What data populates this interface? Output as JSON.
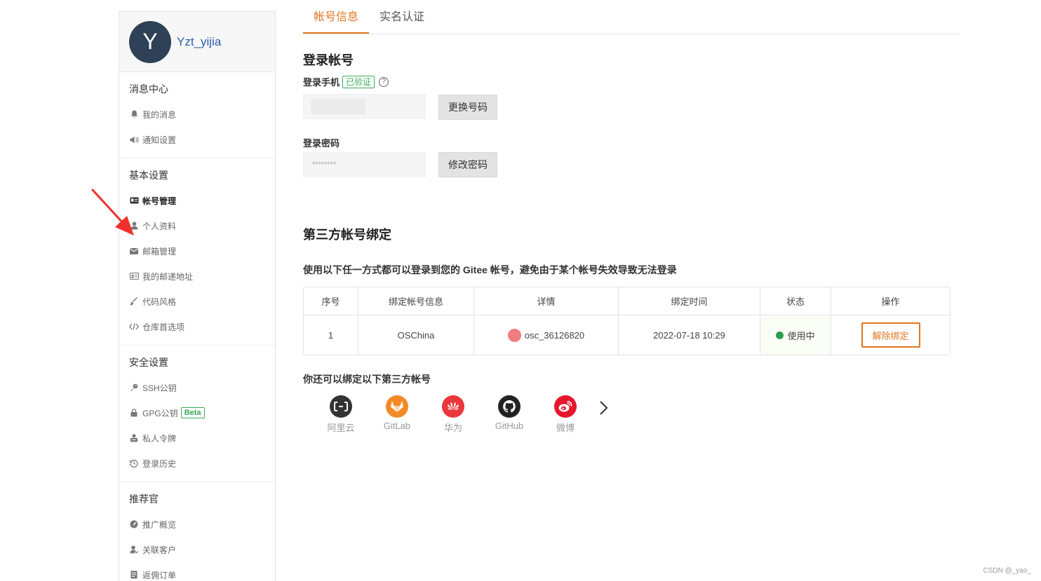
{
  "profile": {
    "avatar_letter": "Y",
    "username": "Yzt_yijia"
  },
  "sidebar": {
    "groups": [
      {
        "title": "消息中心",
        "items": [
          {
            "label": "我的消息",
            "icon": "bell-icon"
          },
          {
            "label": "通知设置",
            "icon": "speaker-icon"
          }
        ]
      },
      {
        "title": "基本设置",
        "items": [
          {
            "label": "帐号管理",
            "icon": "id-card-icon"
          },
          {
            "label": "个人资料",
            "icon": "user-icon"
          },
          {
            "label": "邮箱管理",
            "icon": "mail-icon"
          },
          {
            "label": "我的邮递地址",
            "icon": "address-card-icon"
          },
          {
            "label": "代码风格",
            "icon": "brush-icon"
          },
          {
            "label": "仓库首选项",
            "icon": "code-icon"
          }
        ]
      },
      {
        "title": "安全设置",
        "items": [
          {
            "label": "SSH公钥",
            "icon": "key-icon"
          },
          {
            "label": "GPG公钥",
            "icon": "lock-icon",
            "badge": "Beta"
          },
          {
            "label": "私人令牌",
            "icon": "token-icon"
          },
          {
            "label": "登录历史",
            "icon": "history-icon"
          }
        ]
      },
      {
        "title": "推荐官",
        "items": [
          {
            "label": "推广概览",
            "icon": "gauge-icon"
          },
          {
            "label": "关联客户",
            "icon": "user-link-icon"
          },
          {
            "label": "返佣订单",
            "icon": "order-icon"
          }
        ]
      }
    ]
  },
  "tabs": [
    {
      "label": "帐号信息",
      "active": true
    },
    {
      "label": "实名认证",
      "active": false
    }
  ],
  "login": {
    "title": "登录帐号",
    "phone_label": "登录手机",
    "verified_badge": "已验证",
    "help_glyph": "?",
    "change_phone_button": "更换号码",
    "password_label": "登录密码",
    "password_mask": "********",
    "change_password_button": "修改密码"
  },
  "third_party": {
    "title": "第三方帐号绑定",
    "description": "使用以下任一方式都可以登录到您的 Gitee 帐号，避免由于某个帐号失效导致无法登录",
    "table": {
      "headers": [
        "序号",
        "绑定帐号信息",
        "详情",
        "绑定时间",
        "状态",
        "操作"
      ],
      "rows": [
        {
          "index": "1",
          "account": "OSChina",
          "detail": "osc_36126820",
          "time": "2022-07-18 10:29",
          "status": "使用中",
          "action": "解除绑定"
        }
      ]
    },
    "more_title": "你还可以绑定以下第三方帐号",
    "providers": [
      {
        "label": "阿里云",
        "icon": "aliyun-icon",
        "color": "#333333"
      },
      {
        "label": "GitLab",
        "icon": "gitlab-icon",
        "color": "#f38a27"
      },
      {
        "label": "华为",
        "icon": "huawei-icon",
        "color": "#e8383d"
      },
      {
        "label": "GitHub",
        "icon": "github-icon",
        "color": "#222222"
      },
      {
        "label": "微博",
        "icon": "weibo-icon",
        "color": "#e6162d"
      }
    ]
  },
  "colors": {
    "accent": "#e0761f",
    "success": "#3aaa5c",
    "link": "#2b5ea7"
  },
  "watermark": "CSDN @_yao_"
}
